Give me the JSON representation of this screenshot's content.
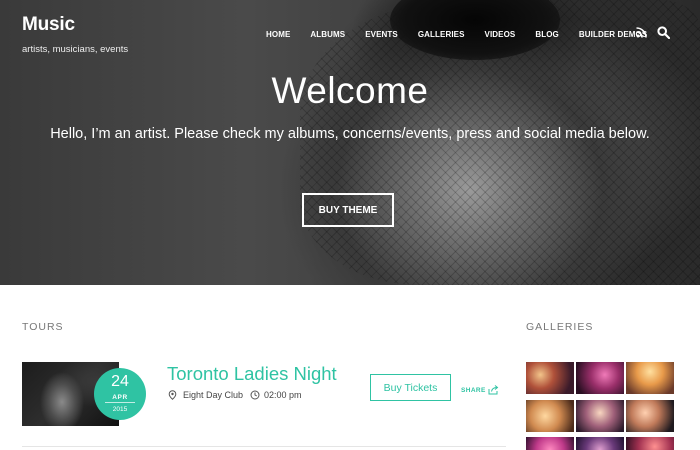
{
  "site": {
    "title": "Music",
    "tagline": "artists, musicians, events"
  },
  "nav": {
    "items": [
      "HOME",
      "ALBUMS",
      "EVENTS",
      "GALLERIES",
      "VIDEOS",
      "BLOG",
      "BUILDER DEMOS"
    ],
    "icons": [
      "rss-icon",
      "search-icon"
    ]
  },
  "hero": {
    "title": "Welcome",
    "subtitle": "Hello, I’m an artist. Please check my albums, concerns/events, press and social media below.",
    "button_label": "BUY THEME"
  },
  "tours": {
    "heading": "TOURS",
    "items": [
      {
        "day": "24",
        "month": "APR",
        "year": "2015",
        "title": "Toronto Ladies Night",
        "venue": "Eight Day Club",
        "time": "02:00 pm",
        "button_label": "Buy Tickets",
        "share_label": "SHARE"
      }
    ]
  },
  "galleries": {
    "heading": "GALLERIES",
    "thumbnails": [
      "party-photo-1",
      "party-photo-2",
      "party-photo-3",
      "party-photo-4",
      "party-photo-5",
      "party-photo-6",
      "party-photo-7",
      "party-photo-8",
      "party-photo-9"
    ]
  },
  "colors": {
    "accent": "#2fc3a3",
    "hero_text": "#ffffff",
    "heading_gray": "#777777"
  }
}
